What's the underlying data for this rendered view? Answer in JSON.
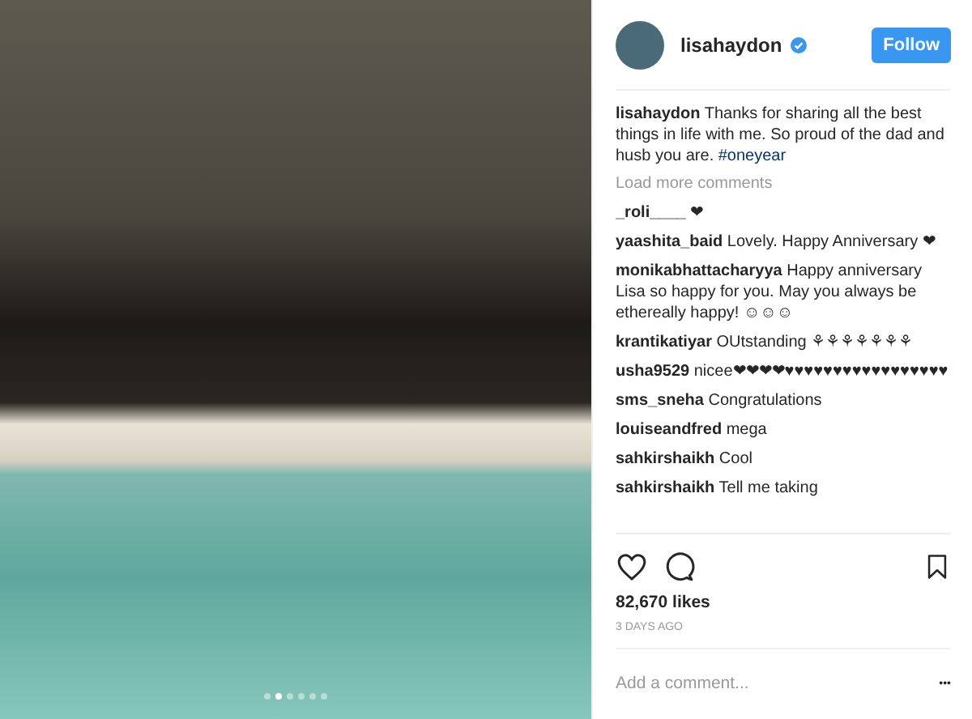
{
  "post": {
    "username": "lisahaydon",
    "verified": true,
    "follow_button": "Follow",
    "carousel_dots": [
      {
        "selected": false
      },
      {
        "selected": true
      },
      {
        "selected": false
      },
      {
        "selected": false
      },
      {
        "selected": false
      },
      {
        "selected": false
      }
    ],
    "caption": {
      "username": "lisahaydon",
      "text": "Thanks for sharing all the best things in life with me. So proud of the dad and husb you are.",
      "hashtag": "#oneyear"
    },
    "load_more": "Load more comments",
    "comments": [
      {
        "username": "_roli____",
        "text": "❤"
      },
      {
        "username": "yaashita_baid",
        "text": "Lovely. Happy Anniversary ❤"
      },
      {
        "username": "monikabhattacharyya",
        "text": "Happy anniversary Lisa so happy for you. May you always be ethereally happy! ☺☺☺"
      },
      {
        "username": "krantikatiyar",
        "text": "OUtstanding ⚘⚘⚘⚘⚘⚘⚘"
      },
      {
        "username": "usha9529",
        "text": "nicee❤❤❤❤♥♥♥♥♥♥♥♥♥♥♥♥♥♥♥♥♥"
      },
      {
        "username": "sms_sneha",
        "text": "Congratulations"
      },
      {
        "username": "louiseandfred",
        "text": "mega"
      },
      {
        "username": "sahkirshaikh",
        "text": "Cool"
      },
      {
        "username": "sahkirshaikh",
        "text": "Tell me taking"
      }
    ],
    "likes": "82,670 likes",
    "time": "3 DAYS AGO",
    "comment_placeholder": "Add a comment...",
    "more": "•••"
  }
}
